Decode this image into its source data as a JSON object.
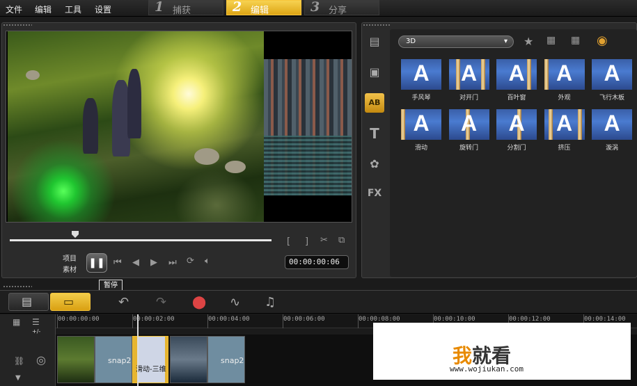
{
  "menu": {
    "file": "文件",
    "edit": "编辑",
    "tools": "工具",
    "settings": "设置"
  },
  "steps": [
    {
      "num": "1",
      "label": "捕获"
    },
    {
      "num": "2",
      "label": "编辑"
    },
    {
      "num": "3",
      "label": "分享"
    }
  ],
  "player": {
    "mode_project": "项目",
    "mode_clip": "素材",
    "pause_tooltip": "暂停",
    "timecode": "00:00:00:06",
    "progress": 0.25
  },
  "library": {
    "category": "3D",
    "transitions": [
      "手风琴",
      "对开门",
      "百叶窗",
      "外观",
      "飞行木板",
      "滑动",
      "旋转门",
      "分割门",
      "挤压",
      "漩涡"
    ],
    "thumb_letter": "A",
    "fx_tab": "FX",
    "title_tab": "T",
    "ab_tab": "AB"
  },
  "timeline": {
    "ticks": [
      "00:00:00:00",
      "00:00:02:00",
      "00:00:04:00",
      "00:00:06:00",
      "00:00:08:00",
      "00:00:10:00",
      "00:00:12:00",
      "00:00:14:00"
    ],
    "clips": {
      "clip_a": "snap2",
      "clip_b": "snap2",
      "transition": "滑动-三维"
    },
    "track_controls": "+/-"
  },
  "watermark": {
    "wo": "我",
    "rest": "就看",
    "url": "www.wojiukan.com"
  },
  "colors": {
    "accent": "#f0c030",
    "panel": "#2b2b2b"
  }
}
